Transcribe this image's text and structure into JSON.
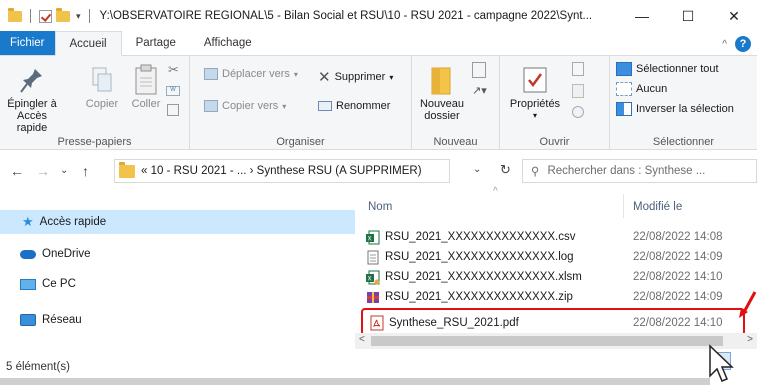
{
  "window": {
    "title": "Y:\\OBSERVATOIRE REGIONAL\\5 - Bilan Social et RSU\\10 - RSU 2021 - campagne 2022\\Synt...",
    "minimize": "—",
    "maximize": "☐",
    "close": "✕"
  },
  "tabs": [
    "Fichier",
    "Accueil",
    "Partage",
    "Affichage"
  ],
  "ribbon": {
    "presse_papiers": {
      "label": "Presse-papiers",
      "pin": "Épingler à\nAccès rapide",
      "copy": "Copier",
      "paste": "Coller"
    },
    "organiser": {
      "label": "Organiser",
      "move": "Déplacer vers",
      "copy_to": "Copier vers",
      "delete": "Supprimer",
      "rename": "Renommer"
    },
    "nouveau": {
      "label": "Nouveau",
      "new_folder": "Nouveau\ndossier"
    },
    "ouvrir": {
      "label": "Ouvrir",
      "properties": "Propriétés"
    },
    "selectionner": {
      "label": "Sélectionner",
      "select_all": "Sélectionner tout",
      "none": "Aucun",
      "invert": "Inverser la sélection"
    }
  },
  "address": {
    "path": "« 10 - RSU 2021 - ... › Synthese RSU (A SUPPRIMER)",
    "search_placeholder": "Rechercher dans : Synthese ..."
  },
  "sidebar": {
    "items": [
      {
        "label": "Accès rapide",
        "icon": "star-icon"
      },
      {
        "label": "OneDrive",
        "icon": "cloud-icon"
      },
      {
        "label": "Ce PC",
        "icon": "computer-icon"
      },
      {
        "label": "Réseau",
        "icon": "network-icon"
      }
    ]
  },
  "filelist": {
    "col_name": "Nom",
    "col_modified": "Modifié le",
    "files": [
      {
        "name": "RSU_2021_XXXXXXXXXXXXXX.csv",
        "date": "22/08/2022 14:08",
        "type": "csv"
      },
      {
        "name": "RSU_2021_XXXXXXXXXXXXXX.log",
        "date": "22/08/2022 14:09",
        "type": "log"
      },
      {
        "name": "RSU_2021_XXXXXXXXXXXXXX.xlsm",
        "date": "22/08/2022 14:10",
        "type": "xlsm"
      },
      {
        "name": "RSU_2021_XXXXXXXXXXXXXX.zip",
        "date": "22/08/2022 14:09",
        "type": "zip"
      },
      {
        "name": "Synthese_RSU_2021.pdf",
        "date": "22/08/2022 14:10",
        "type": "pdf"
      }
    ]
  },
  "status": {
    "count": "5 élément(s)"
  },
  "colors": {
    "accent": "#1979ca",
    "highlight": "#e01010",
    "selected": "#cce8ff"
  }
}
